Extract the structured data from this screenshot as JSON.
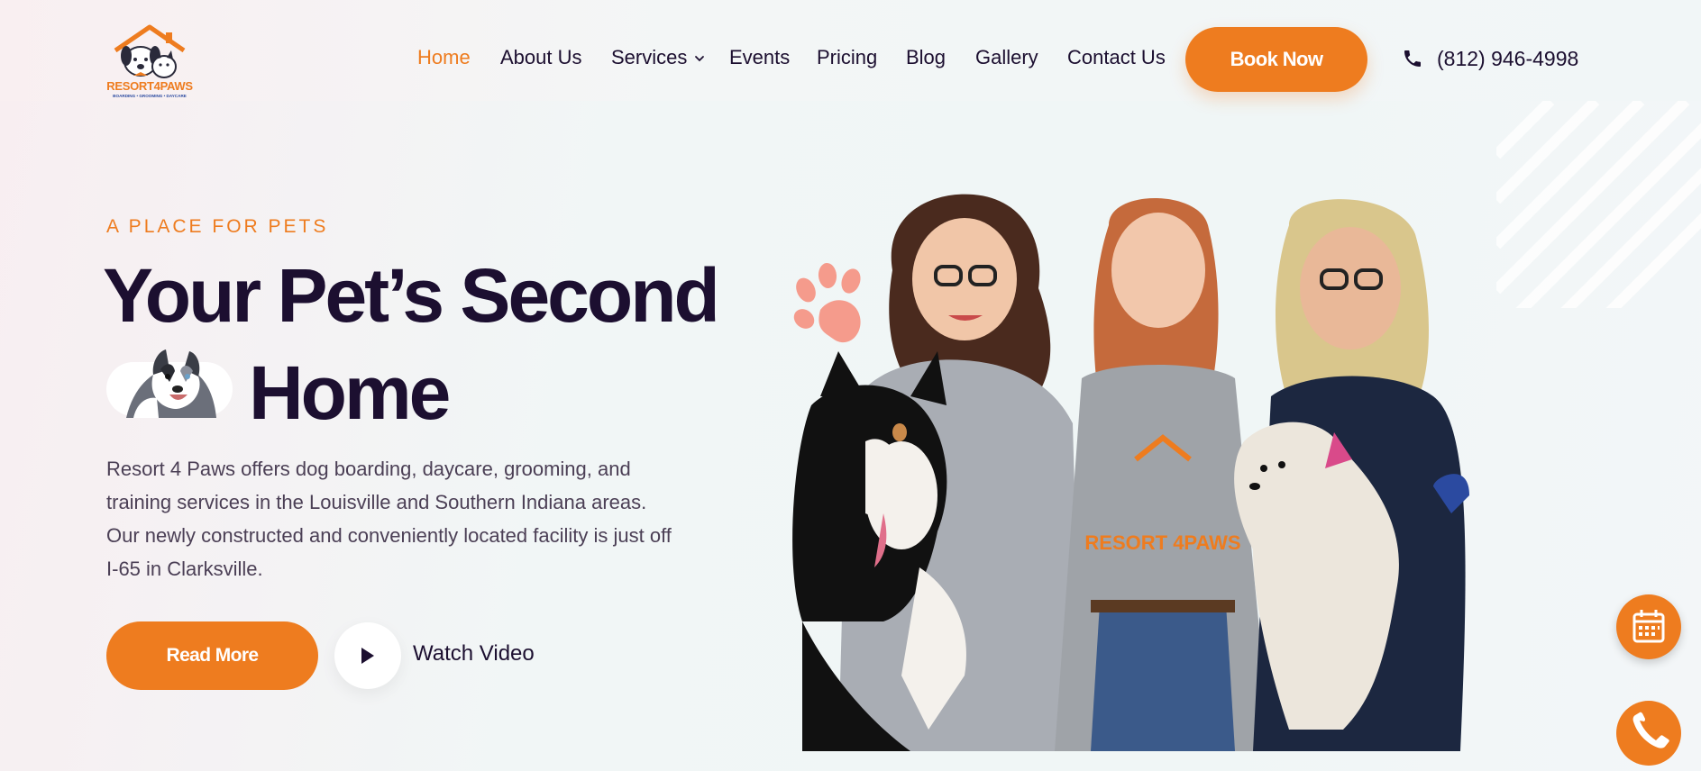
{
  "brand": {
    "logo_text": "RESORT4PAWS",
    "logo_tagline": "BOARDING • GROOMING • DAYCARE",
    "accent_color": "#ee7c1f",
    "text_color": "#1c0f30"
  },
  "nav": {
    "items": [
      {
        "label": "Home",
        "active": true
      },
      {
        "label": "About Us",
        "active": false
      },
      {
        "label": "Services",
        "active": false,
        "has_dropdown": true
      },
      {
        "label": "Events",
        "active": false
      },
      {
        "label": "Pricing",
        "active": false
      },
      {
        "label": "Blog",
        "active": false
      },
      {
        "label": "Gallery",
        "active": false
      },
      {
        "label": "Contact Us",
        "active": false
      }
    ],
    "cta_label": "Book Now",
    "phone": "(812) 946-4998"
  },
  "hero": {
    "eyebrow": "A PLACE FOR PETS",
    "title_line1": "Your Pet’s Second",
    "title_line2": "Home",
    "lead": "Resort 4 Paws offers dog boarding, daycare, grooming, and training services in the Louisville and Southern Indiana areas. Our newly constructed and conveniently located facility is just off I-65 in Clarksville.",
    "read_more_label": "Read More",
    "watch_video_label": "Watch Video",
    "shirt_logo_text": "RESORT 4PAWS"
  },
  "icons": {
    "phone": "phone-icon",
    "play": "play-icon",
    "calendar": "calendar-icon",
    "paw": "paw-icon",
    "chevron": "chevron-down-icon"
  }
}
